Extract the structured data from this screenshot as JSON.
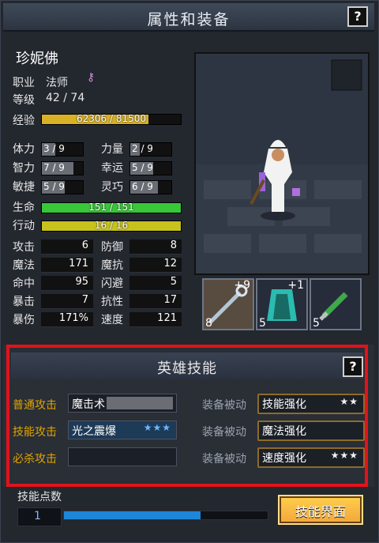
{
  "window": {
    "title": "属性和装备",
    "help": "?"
  },
  "character": {
    "name": "珍妮佛",
    "class_label": "职业",
    "class_value": "法师",
    "level_label": "等级",
    "level_value": "42 / 74",
    "exp_label": "经验",
    "exp_text": "62306 / 81500",
    "exp_fraction": 0.7645
  },
  "attributes": [
    {
      "label": "体力",
      "value": "3 / 9",
      "fraction": 0.333
    },
    {
      "label": "力量",
      "value": "2 / 9",
      "fraction": 0.222
    },
    {
      "label": "智力",
      "value": "7 / 9",
      "fraction": 0.777
    },
    {
      "label": "幸运",
      "value": "5 / 9",
      "fraction": 0.555
    },
    {
      "label": "敏捷",
      "value": "5 / 9",
      "fraction": 0.555
    },
    {
      "label": "灵巧",
      "value": "6 / 9",
      "fraction": 0.666
    }
  ],
  "vitals": {
    "hp_label": "生命",
    "hp_text": "151 / 151",
    "hp_fraction": 1.0,
    "ap_label": "行动",
    "ap_text": "16 / 16",
    "ap_fraction": 1.0,
    "hp_color": "#37c739",
    "ap_color": "#c8c21f"
  },
  "combat": [
    {
      "label": "攻击",
      "value": "6"
    },
    {
      "label": "防御",
      "value": "8"
    },
    {
      "label": "魔法",
      "value": "171"
    },
    {
      "label": "魔抗",
      "value": "12"
    },
    {
      "label": "命中",
      "value": "95"
    },
    {
      "label": "闪避",
      "value": "5"
    },
    {
      "label": "暴击",
      "value": "7"
    },
    {
      "label": "抗性",
      "value": "17"
    },
    {
      "label": "暴伤",
      "value": "171%"
    },
    {
      "label": "速度",
      "value": "121"
    }
  ],
  "equipment": [
    {
      "count": "8",
      "plus": "+9",
      "icon": "staff-icon"
    },
    {
      "count": "5",
      "plus": "+1",
      "icon": "cloak-icon"
    },
    {
      "count": "5",
      "plus": "",
      "icon": "dagger-icon"
    }
  ],
  "skills": {
    "title": "英雄技能",
    "help": "?",
    "active": [
      {
        "label": "普通攻击",
        "name": "魔击术",
        "stars": ""
      },
      {
        "label": "技能攻击",
        "name": "光之震爆",
        "stars": "★★★"
      },
      {
        "label": "必杀攻击",
        "name": "",
        "stars": ""
      }
    ],
    "passive": [
      {
        "label": "装备被动",
        "name": "技能强化",
        "stars": "★★"
      },
      {
        "label": "装备被动",
        "name": "魔法强化",
        "stars": ""
      },
      {
        "label": "装备被动",
        "name": "速度强化",
        "stars": "★★★"
      }
    ]
  },
  "footer": {
    "points_label": "技能点数",
    "points_value": "1",
    "points_fraction": 0.67,
    "button_label": "技能界面"
  },
  "colors": {
    "accent": "#e3121b",
    "gold": "#d8b127",
    "blue": "#1d86d8"
  }
}
